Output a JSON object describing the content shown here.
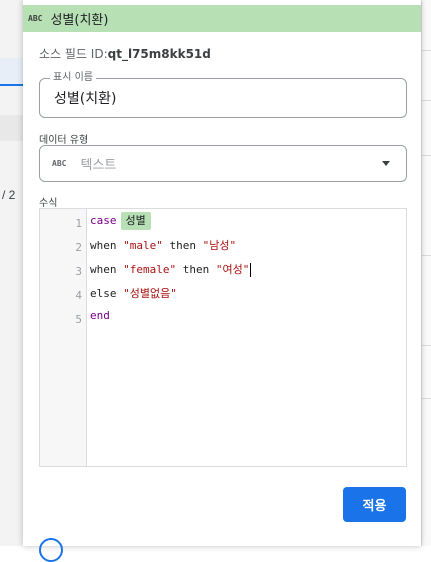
{
  "background": {
    "left_fragment_text": "/ 2"
  },
  "panel": {
    "header": {
      "type_icon": "ABC",
      "title": "성별(치환)"
    },
    "source_field": {
      "label": "소스 필드 ID:",
      "value": "qt_l75m8kk51d"
    },
    "display_name": {
      "legend": "표시 이름",
      "value": "성별(치환)"
    },
    "data_type": {
      "label": "데이터 유형",
      "type_icon": "ABC",
      "value": "텍스트"
    },
    "formula": {
      "label": "수식",
      "line_numbers": [
        "1",
        "2",
        "3",
        "4",
        "5"
      ],
      "line1": {
        "kw": "case",
        "field_chip": "성별"
      },
      "line2": {
        "kw_when": "when",
        "str1": "\"male\"",
        "kw_then": "then",
        "str2": "\"남성\""
      },
      "line3": {
        "kw_when": "when",
        "str1": "\"female\"",
        "kw_then": "then",
        "str2": "\"여성\""
      },
      "line4": {
        "kw_else": "else",
        "str1": "\"성별없음\""
      },
      "line5": {
        "kw_end": "end"
      }
    },
    "apply_button": "적용"
  },
  "colors": {
    "header_bg": "#b7e1b5",
    "accent": "#1a73e8",
    "keyword": "#770088",
    "string": "#aa1111"
  }
}
